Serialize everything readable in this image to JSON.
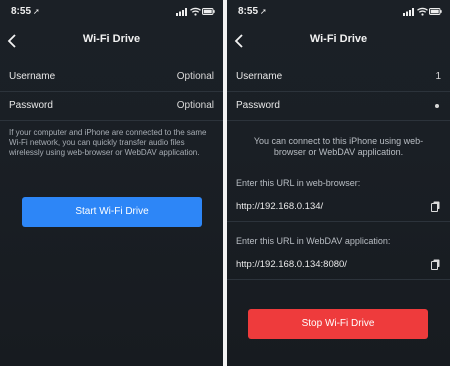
{
  "status": {
    "time": "8:55",
    "location_icon": "location-arrow-icon"
  },
  "left_screen": {
    "title": "Wi-Fi Drive",
    "username": {
      "label": "Username",
      "value": "Optional"
    },
    "password": {
      "label": "Password",
      "value": "Optional"
    },
    "info": "If your computer and iPhone are connected to the same Wi-Fi network, you can quickly transfer audio files wirelessly using web-browser or WebDAV application.",
    "start_button": "Start Wi-Fi Drive"
  },
  "right_screen": {
    "title": "Wi-Fi Drive",
    "username": {
      "label": "Username",
      "value": "1"
    },
    "password": {
      "label": "Password"
    },
    "info": "You can connect to this iPhone using web-browser or WebDAV application.",
    "browser_label": "Enter this URL in web-browser:",
    "browser_url": "http://192.168.0.134/",
    "webdav_label": "Enter this URL in WebDAV application:",
    "webdav_url": "http://192.168.0.134:8080/",
    "stop_button": "Stop Wi-Fi Drive"
  },
  "colors": {
    "start": "#2d86f7",
    "stop": "#ee3b3c",
    "background": "#1a1f25"
  }
}
